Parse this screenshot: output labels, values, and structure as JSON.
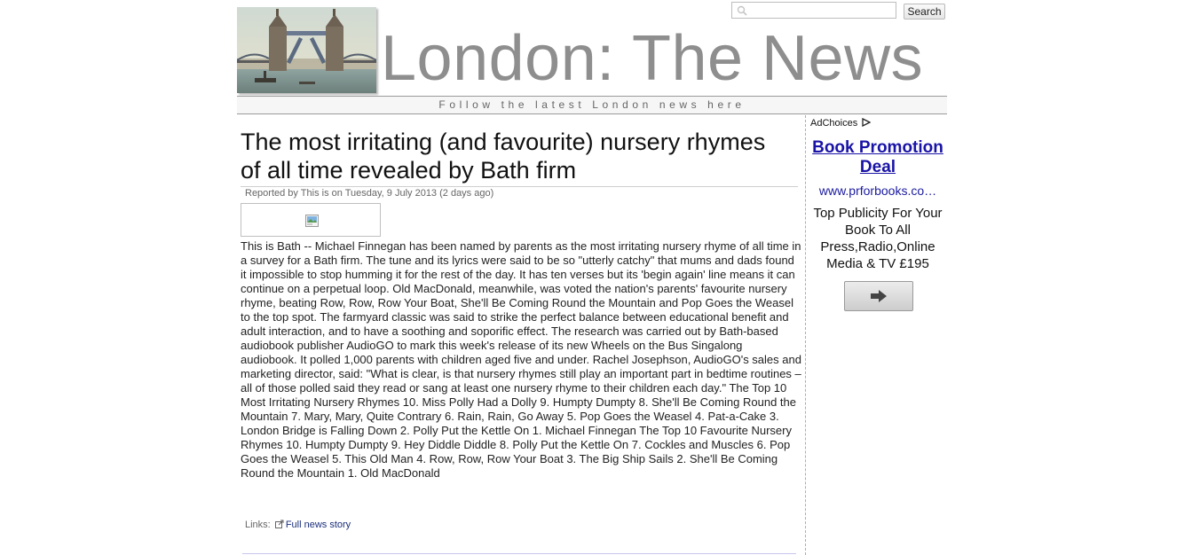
{
  "search": {
    "placeholder": "",
    "button_label": "Search"
  },
  "header": {
    "site_title": "London: The News",
    "tagline": "Follow the latest London news here"
  },
  "article": {
    "headline": "The most irritating (and favourite) nursery rhymes of all time revealed by Bath firm",
    "byline": "Reported by This is on Tuesday, 9 July 2013 (2 days ago)",
    "body": "This is Bath -- Michael Finnegan has been named by parents as the most irritating nursery rhyme of all time in a survey for a Bath firm. The tune and its lyrics were said to be so \"utterly catchy\" that mums and dads found it impossible to stop humming it for the rest of the day. It has ten verses but its 'begin again' line means it can continue on a perpetual loop. Old MacDonald, meanwhile, was voted the nation's parents' favourite nursery rhyme, beating Row, Row, Row Your Boat, She'll Be Coming Round the Mountain and Pop Goes the Weasel to the top spot. The farmyard classic was said to strike the perfect balance between educational benefit and adult interaction, and to have a soothing and soporific effect. The research was carried out by Bath-based audiobook publisher AudioGO to mark this week's release of its new Wheels on the Bus Singalong audiobook. It polled 1,000 parents with children aged five and under. Rachel Josephson, AudioGO's sales and marketing director, said: \"What is clear, is that nursery rhymes still play an important part in bedtime routines – all of those polled said they read or sang at least one nursery rhyme to their children each day.\" The Top 10 Most Irritating Nursery Rhymes 10. Miss Polly Had a Dolly 9. Humpty Dumpty 8. She'll Be Coming Round the Mountain 7. Mary, Mary, Quite Contrary 6. Rain, Rain, Go Away 5. Pop Goes the Weasel 4. Pat-a-Cake 3. London Bridge is Falling Down 2. Polly Put the Kettle On 1. Michael Finnegan The Top 10 Favourite Nursery Rhymes 10. Humpty Dumpty 9. Hey Diddle Diddle 8. Polly Put the Kettle On 7. Cockles and Muscles 6. Pop Goes the Weasel 5. This Old Man 4. Row, Row, Row Your Boat 3. The Big Ship Sails 2. She'll Be Coming Round the Mountain 1. Old MacDonald",
    "links_label": "Links:",
    "link_text": "Full news story"
  },
  "ad": {
    "adchoices_label": "AdChoices",
    "title": "Book Promotion Deal",
    "url": "www.prforbooks.co…",
    "text": "Top Publicity For Your Book To All Press,Radio,Online Media & TV £195"
  },
  "icons": {
    "search": "search-icon",
    "external_link": "external-link-icon",
    "adchoices": "adchoices-icon",
    "arrow": "arrow-right-icon",
    "broken_image": "broken-image-icon"
  }
}
